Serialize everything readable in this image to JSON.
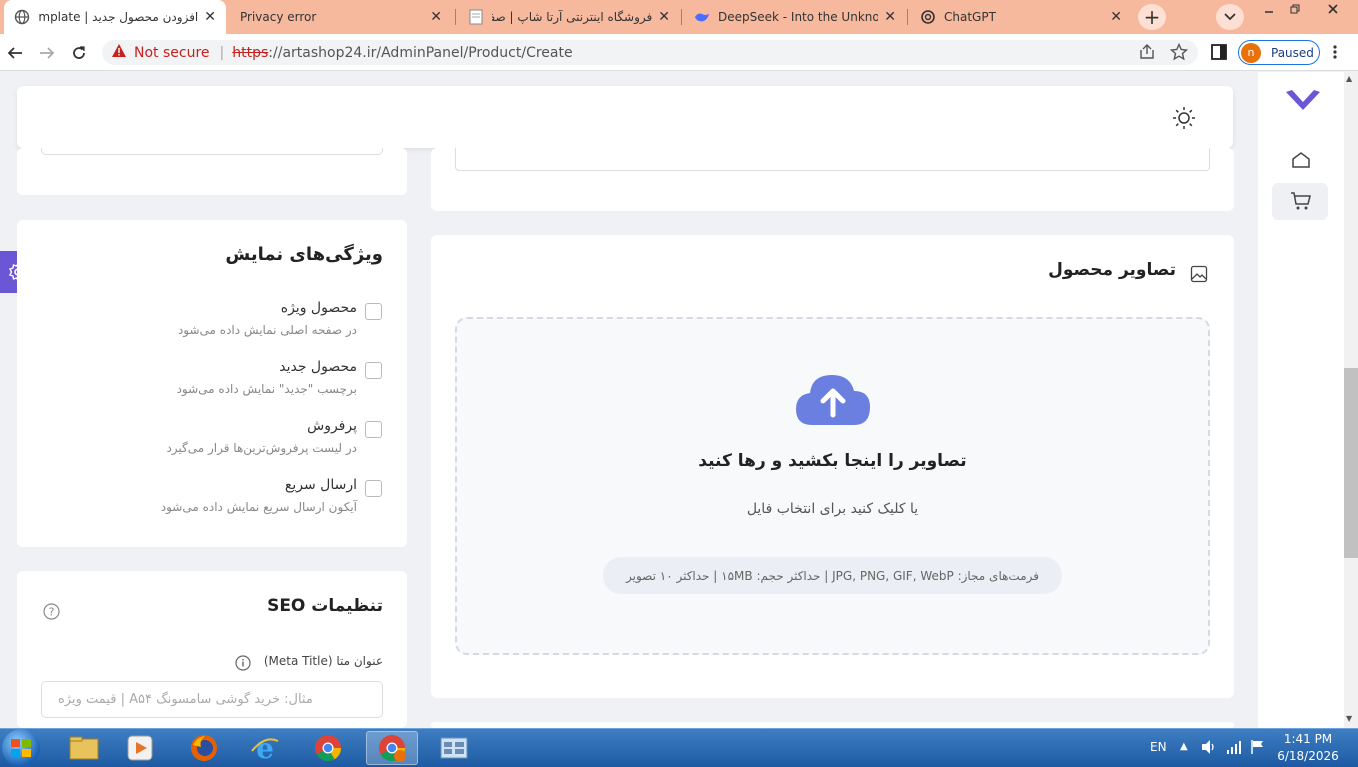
{
  "browser": {
    "tabs": [
      {
        "label": "افزودن محصول جدید | Admin Template",
        "icon": "globe-icon"
      },
      {
        "label": "Privacy error",
        "icon": "none"
      },
      {
        "label": "فروشگاه اینترنتی آرتا شاپ | صفحه اصلی",
        "icon": "page-icon"
      },
      {
        "label": "DeepSeek - Into the Unknown",
        "icon": "deepseek-icon"
      },
      {
        "label": "ChatGPT",
        "icon": "chatgpt-icon"
      }
    ],
    "address": {
      "security_label": "Not secure",
      "scheme": "https",
      "rest": "://artashop24.ir/AdminPanel/Product/Create"
    },
    "profile": {
      "initial": "n",
      "status": "Paused"
    }
  },
  "display_features": {
    "title": "ویژگی‌های نمایش",
    "options": [
      {
        "label": "محصول ویژه",
        "desc": "در صفحه اصلی نمایش داده می‌شود"
      },
      {
        "label": "محصول جدید",
        "desc": "برچسب \"جدید\" نمایش داده می‌شود"
      },
      {
        "label": "پرفروش",
        "desc": "در لیست پرفروش‌ترین‌ها قرار می‌گیرد"
      },
      {
        "label": "ارسال سریع",
        "desc": "آیکون ارسال سریع نمایش داده می‌شود"
      }
    ]
  },
  "seo": {
    "title": "تنظیمات SEO",
    "meta_title_label": "عنوان متا (Meta Title)",
    "meta_title_placeholder": "مثال: خرید گوشی سامسونگ A۵۴ | قیمت ویژه"
  },
  "images": {
    "title": "تصاویر محصول",
    "drop_text": "تصاویر را اینجا بکشید و رها کنید",
    "click_text": "یا کلیک کنید برای انتخاب فایل",
    "formats_text": "فرمت‌های مجاز: JPG, PNG, GIF, WebP | حداکثر حجم: ۱۵MB | حداکثر ۱۰ تصویر"
  },
  "colors": {
    "accent": "#6b7fe0",
    "tab_bar": "#f6b99e"
  },
  "taskbar": {
    "lang": "EN",
    "time": "1:41 PM",
    "date": "6/18/2026"
  }
}
